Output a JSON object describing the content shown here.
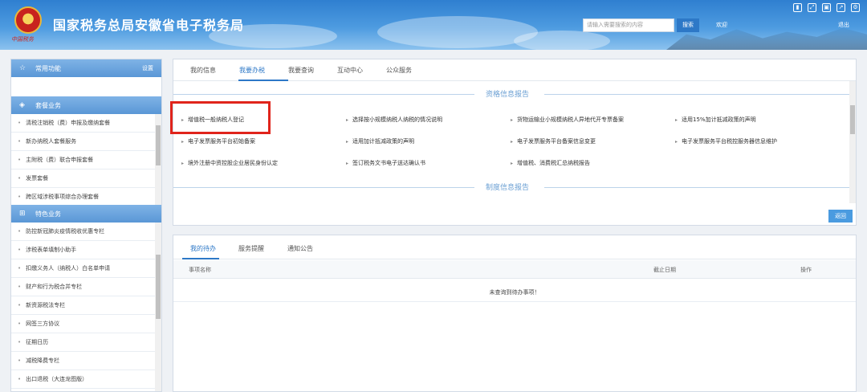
{
  "header": {
    "title": "国家税务总局安徽省电子税务局",
    "emblem_caption": "中国税务",
    "search_placeholder": "请输入需要搜索的内容",
    "search_button": "搜索",
    "welcome": "欢迎",
    "logout": "退出",
    "colors": {
      "header_top": "#2f7fd0",
      "header_bottom": "#8cc2ee"
    }
  },
  "sidebar": {
    "common": {
      "label": "常用功能",
      "settings": "设置"
    },
    "package": {
      "label": "套餐业务",
      "items": [
        "清税注销税（费）申报及缴纳套餐",
        "新办纳税人套餐服务",
        "主附税（费）联合申报套餐",
        "发票套餐",
        "跨区域涉税事项综合办理套餐"
      ]
    },
    "special": {
      "label": "特色业务",
      "items": [
        "防控新冠肺炎疫情税收优惠专栏",
        "涉税表单填制小助手",
        "扣缴义务人（纳税人）白名单申请",
        "财产和行为税合并专栏",
        "新资源税法专栏",
        "网签三方协议",
        "征期日历",
        "减税降费专栏",
        "出口退税（大连龙图版）"
      ]
    }
  },
  "main": {
    "tabs": [
      "我的信息",
      "我要办税",
      "我要查询",
      "互动中心",
      "公众服务"
    ],
    "active_tab": "我要办税",
    "section1_title": "资格信息报告",
    "section2_title": "制度信息报告",
    "links": [
      "增值税一般纳税人登记",
      "选择按小规模纳税人纳税的情况说明",
      "货物运输业小规模纳税人异地代开专票备案",
      "适用15%加计抵减政策的声明",
      "电子发票服务平台初始备案",
      "适用加计抵减政策的声明",
      "电子发票服务平台备案信息变更",
      "电子发票服务平台税控服务器信息维护",
      "境外注册中资控股企业居民身份认定",
      "签订税务文书电子送达确认书",
      "增值税、消费税汇总纳税报告"
    ],
    "back_button": "返回",
    "accent_color": "#2d78c7",
    "highlight_color": "#e0241b"
  },
  "tasks": {
    "tabs": [
      "我的待办",
      "服务提醒",
      "通知公告"
    ],
    "active_tab": "我的待办",
    "columns": [
      "事项名称",
      "截止日期",
      "操作"
    ],
    "empty_message": "未查询到待办事项！"
  }
}
